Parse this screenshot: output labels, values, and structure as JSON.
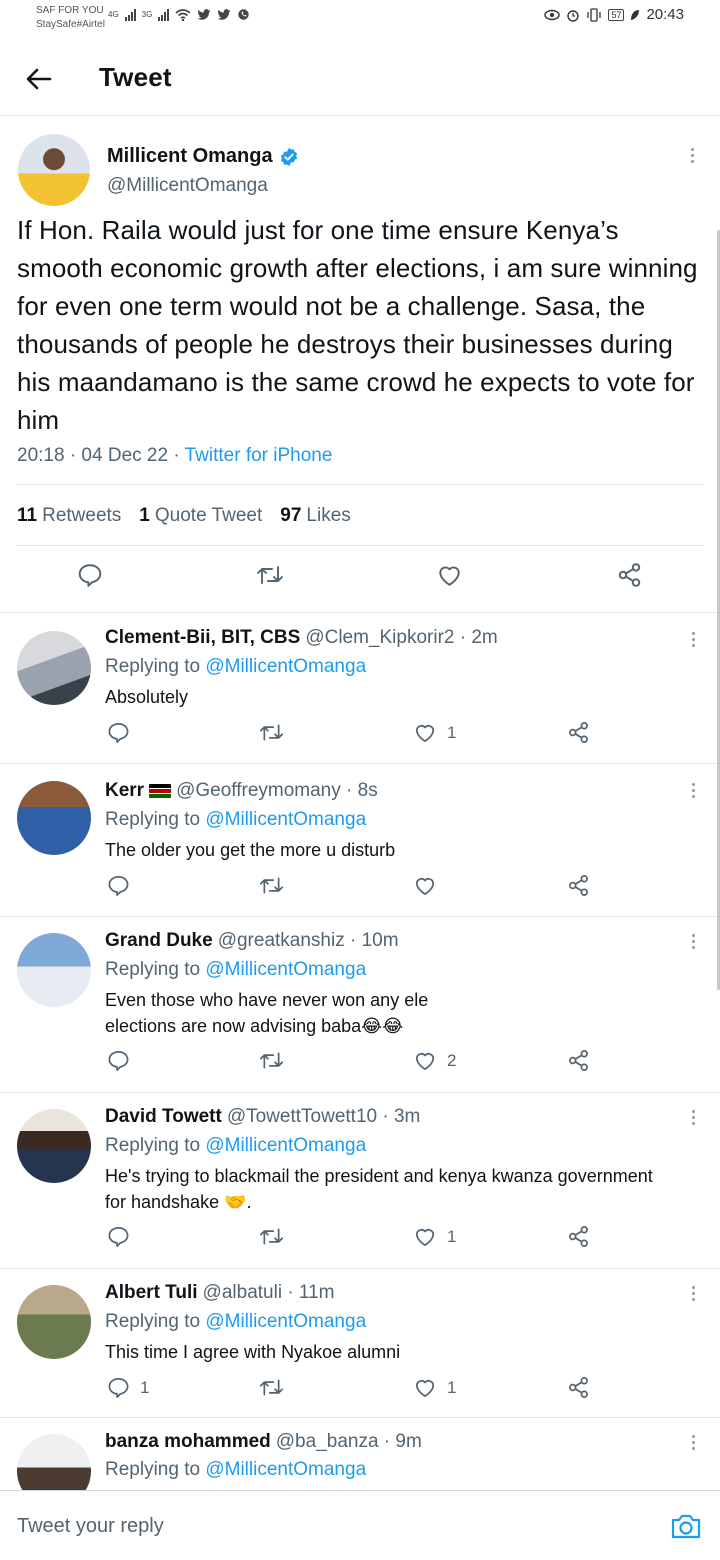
{
  "status_bar": {
    "carrier_line1": "SAF FOR YOU",
    "carrier_line2": "StaySafe#Airtel",
    "net1": "4G",
    "net2": "3G",
    "battery": "57",
    "time": "20:43"
  },
  "header": {
    "title": "Tweet"
  },
  "main_tweet": {
    "name": "Millicent Omanga",
    "handle": "@MillicentOmanga",
    "text": "If Hon. Raila would just for one time ensure Kenya’s smooth economic growth after elections, i am sure winning for even one term would not be a challenge. Sasa, the thousands of people he destroys their businesses during his maandamano is the same crowd he expects to vote for him",
    "time_date": "20:18 · 04 Dec 22 · ",
    "source": "Twitter for iPhone",
    "retweets_count": "11",
    "retweets_label": "Retweets",
    "quotes_count": "1",
    "quotes_label": "Quote Tweet",
    "likes_count": "97",
    "likes_label": "Likes"
  },
  "replies": [
    {
      "name": "Clement-Bii, BIT, CBS",
      "handle": "@Clem_Kipkorir2 · 2m",
      "replying_prefix": "Replying to ",
      "mention": "@MillicentOmanga",
      "text": "Absolutely",
      "reply_count": "",
      "like_count": "1"
    },
    {
      "name": "Kerr",
      "handle": "@Geoffreymomany · 8s",
      "replying_prefix": "Replying to ",
      "mention": "@MillicentOmanga",
      "text": "The older you get the more u disturb",
      "reply_count": "",
      "like_count": ""
    },
    {
      "name": "Grand Duke",
      "handle": "@greatkanshiz · 10m",
      "replying_prefix": "Replying to ",
      "mention": "@MillicentOmanga",
      "text_line1": "Even those who have never won any ele",
      "text_line2": "elections are now advising baba😂😂",
      "reply_count": "",
      "like_count": "2"
    },
    {
      "name": "David Towett",
      "handle": "@TowettTowett10 · 3m",
      "replying_prefix": "Replying to ",
      "mention": "@MillicentOmanga",
      "text_line1": "He's trying to blackmail  the president and kenya kwanza government",
      "text_line2": "for handshake 🤝.",
      "reply_count": "",
      "like_count": "1"
    },
    {
      "name": "Albert Tuli",
      "handle": "@albatuli · 11m",
      "replying_prefix": "Replying to ",
      "mention": "@MillicentOmanga",
      "text": "This time I agree with Nyakoe alumni",
      "reply_count": "1",
      "like_count": "1"
    },
    {
      "name": "banza mohammed",
      "handle": "@ba_banza · 9m",
      "replying_prefix": "Replying to ",
      "mention": "@MillicentOmanga"
    }
  ],
  "composer": {
    "placeholder": "Tweet your reply"
  },
  "icons": [
    "back-arrow-icon",
    "verified-badge-icon",
    "more-icon",
    "reply-icon",
    "retweet-icon",
    "like-icon",
    "share-icon",
    "camera-icon"
  ],
  "colors": {
    "accent": "#1d9bf0",
    "muted": "#536471",
    "text": "#0f1419",
    "divider": "#e6e6e6"
  }
}
